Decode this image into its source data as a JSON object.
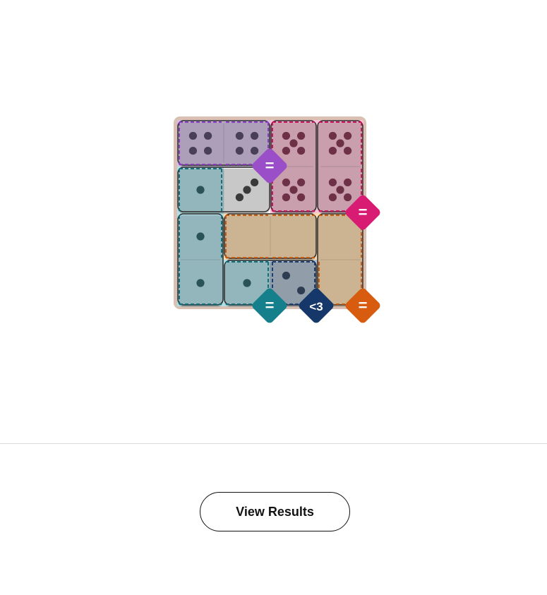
{
  "game": {
    "grid_size": 4,
    "regions": [
      {
        "id": "purple-sum",
        "color": "#8b3fbf",
        "fill": "#d4c2e2",
        "cells": [
          [
            0,
            0
          ],
          [
            0,
            1
          ]
        ],
        "rule": "="
      },
      {
        "id": "pink-sum",
        "color": "#c8175f",
        "fill": "#f6c2d4",
        "cells": [
          [
            0,
            2
          ],
          [
            1,
            2
          ],
          [
            0,
            3
          ],
          [
            1,
            3
          ]
        ],
        "rule": "="
      },
      {
        "id": "teal-sum",
        "color": "#166f79",
        "fill": "#b2dfe6",
        "cells": [
          [
            1,
            0
          ],
          [
            2,
            0
          ],
          [
            3,
            0
          ],
          [
            3,
            1
          ]
        ],
        "rule": "="
      },
      {
        "id": "navy-less",
        "color": "#1e3f73",
        "fill": "#b3c0d0",
        "cells": [
          [
            3,
            2
          ]
        ],
        "rule": "<3"
      },
      {
        "id": "orange-sum",
        "color": "#c45c16",
        "fill": "#f9dcb2",
        "cells": [
          [
            2,
            1
          ],
          [
            2,
            2
          ],
          [
            2,
            3
          ],
          [
            3,
            3
          ]
        ],
        "rule": "="
      },
      {
        "id": "neutral",
        "color": "#9a9a9a",
        "fill": "#f5f5f5",
        "cells": [
          [
            1,
            1
          ]
        ],
        "rule": ""
      }
    ],
    "dominoes": [
      {
        "cells": [
          [
            0,
            0
          ],
          [
            0,
            1
          ]
        ],
        "pips": [
          4,
          4
        ]
      },
      {
        "cells": [
          [
            0,
            2
          ],
          [
            1,
            2
          ]
        ],
        "pips": [
          5,
          5
        ]
      },
      {
        "cells": [
          [
            0,
            3
          ],
          [
            1,
            3
          ]
        ],
        "pips": [
          5,
          5
        ]
      },
      {
        "cells": [
          [
            1,
            0
          ],
          [
            1,
            1
          ]
        ],
        "pips": [
          1,
          3
        ]
      },
      {
        "cells": [
          [
            2,
            0
          ],
          [
            3,
            0
          ]
        ],
        "pips": [
          1,
          1
        ]
      },
      {
        "cells": [
          [
            2,
            1
          ],
          [
            2,
            2
          ]
        ],
        "pips": [
          0,
          0
        ]
      },
      {
        "cells": [
          [
            2,
            3
          ],
          [
            3,
            3
          ]
        ],
        "pips": [
          0,
          0
        ]
      },
      {
        "cells": [
          [
            3,
            1
          ],
          [
            3,
            2
          ]
        ],
        "pips": [
          1,
          2
        ]
      }
    ],
    "badges": [
      {
        "label": "=",
        "color": "#9a4fc8",
        "anchor": [
          0,
          1
        ]
      },
      {
        "label": "=",
        "color": "#d81b73",
        "anchor": [
          1,
          3
        ]
      },
      {
        "label": "=",
        "color": "#157f8c",
        "anchor": [
          3,
          1
        ]
      },
      {
        "label": "<3",
        "color": "#15376a",
        "anchor": [
          3,
          2
        ]
      },
      {
        "label": "=",
        "color": "#d85c0f",
        "anchor": [
          3,
          3
        ]
      }
    ]
  },
  "actions": {
    "view_results": "View Results"
  }
}
